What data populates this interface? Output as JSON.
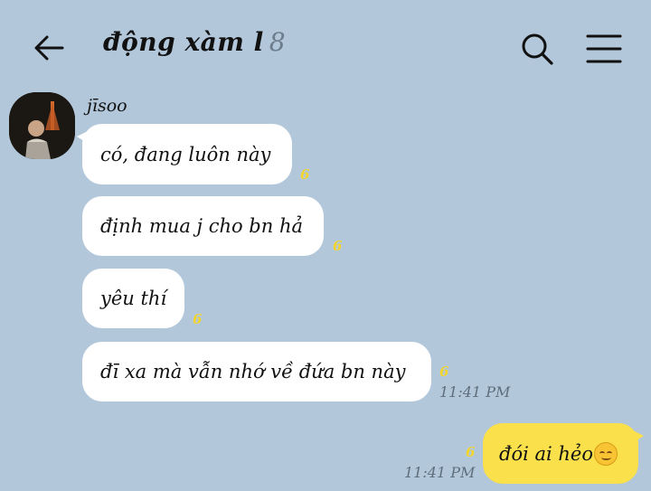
{
  "header": {
    "title": "động xàm l",
    "member_count": "8"
  },
  "chat": {
    "sender_name": "jīsoo",
    "incoming": [
      {
        "text": "có, đang luôn này",
        "unread": "6"
      },
      {
        "text": "định mua j cho bn hả",
        "unread": "6"
      },
      {
        "text": "yêu thí",
        "unread": "6"
      },
      {
        "text": "đī xa mà vẫn nhớ về đứa bn này",
        "unread": "6",
        "time": "11:41 PM"
      }
    ],
    "outgoing": [
      {
        "text": "đói ai hẻo",
        "unread": "6",
        "time": "11:41 PM"
      }
    ]
  },
  "icons": {
    "back": "arrow-left-icon",
    "search": "search-icon",
    "menu": "hamburger-menu-icon",
    "emoji": "smiling-face-icon"
  },
  "colors": {
    "background": "#b2c7da",
    "incoming_bubble": "#ffffff",
    "outgoing_bubble": "#fae04a",
    "unread_count": "#f3d52f",
    "timestamp": "#5f6e7c"
  }
}
